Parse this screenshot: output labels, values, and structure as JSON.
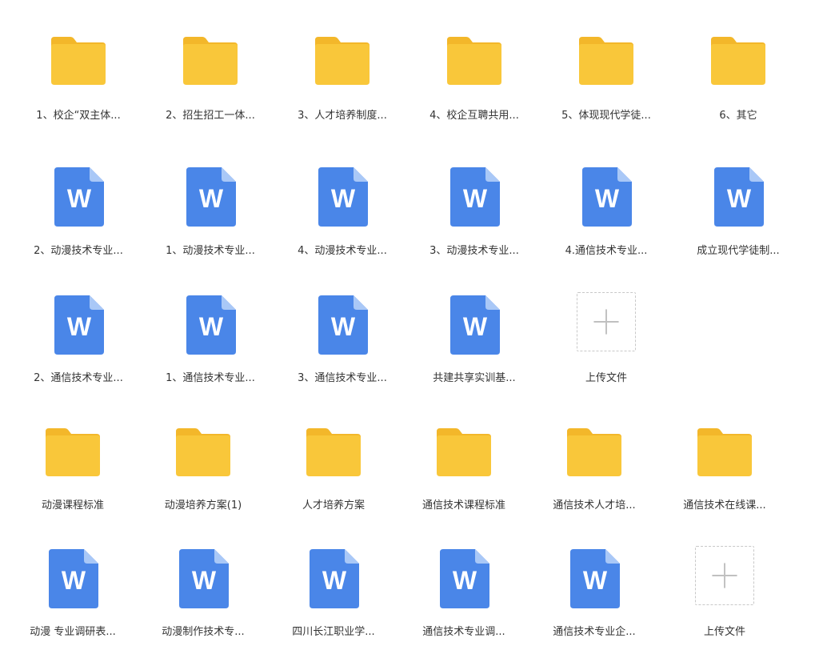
{
  "colors": {
    "folder": "#F9C73A",
    "folder_tab": "#F3B72A",
    "word": "#4A86E8",
    "word_fold": "#A9C8F7",
    "upload_border": "#C8C8C8",
    "upload_plus": "#C0C0C0"
  },
  "rows": [
    [
      {
        "type": "folder",
        "label": "1、校企“双主体..."
      },
      {
        "type": "folder",
        "label": "2、招生招工一体..."
      },
      {
        "type": "folder",
        "label": "3、人才培养制度..."
      },
      {
        "type": "folder",
        "label": "4、校企互聘共用..."
      },
      {
        "type": "folder",
        "label": "5、体现现代学徒..."
      },
      {
        "type": "folder",
        "label": "6、其它"
      }
    ],
    [
      {
        "type": "word",
        "label": "2、动漫技术专业..."
      },
      {
        "type": "word",
        "label": "1、动漫技术专业..."
      },
      {
        "type": "word",
        "label": "4、动漫技术专业..."
      },
      {
        "type": "word",
        "label": "3、动漫技术专业..."
      },
      {
        "type": "word",
        "label": "4.通信技术专业..."
      },
      {
        "type": "word",
        "label": "成立现代学徒制..."
      }
    ],
    [
      {
        "type": "word",
        "label": "2、通信技术专业..."
      },
      {
        "type": "word",
        "label": "1、通信技术专业..."
      },
      {
        "type": "word",
        "label": "3、通信技术专业..."
      },
      {
        "type": "word",
        "label": "共建共享实训基..."
      },
      {
        "type": "upload",
        "label": "上传文件"
      }
    ],
    [
      {
        "type": "folder",
        "label": "动漫课程标准"
      },
      {
        "type": "folder",
        "label": "动漫培养方案(1)"
      },
      {
        "type": "folder",
        "label": "人才培养方案"
      },
      {
        "type": "folder",
        "label": "通信技术课程标准"
      },
      {
        "type": "folder",
        "label": "通信技术人才培..."
      },
      {
        "type": "folder",
        "label": "通信技术在线课..."
      }
    ],
    [
      {
        "type": "word",
        "label": "动漫  专业调研表..."
      },
      {
        "type": "word",
        "label": "动漫制作技术专..."
      },
      {
        "type": "word",
        "label": "四川长江职业学..."
      },
      {
        "type": "word",
        "label": "通信技术专业调..."
      },
      {
        "type": "word",
        "label": "通信技术专业企..."
      },
      {
        "type": "upload",
        "label": "上传文件"
      }
    ]
  ]
}
